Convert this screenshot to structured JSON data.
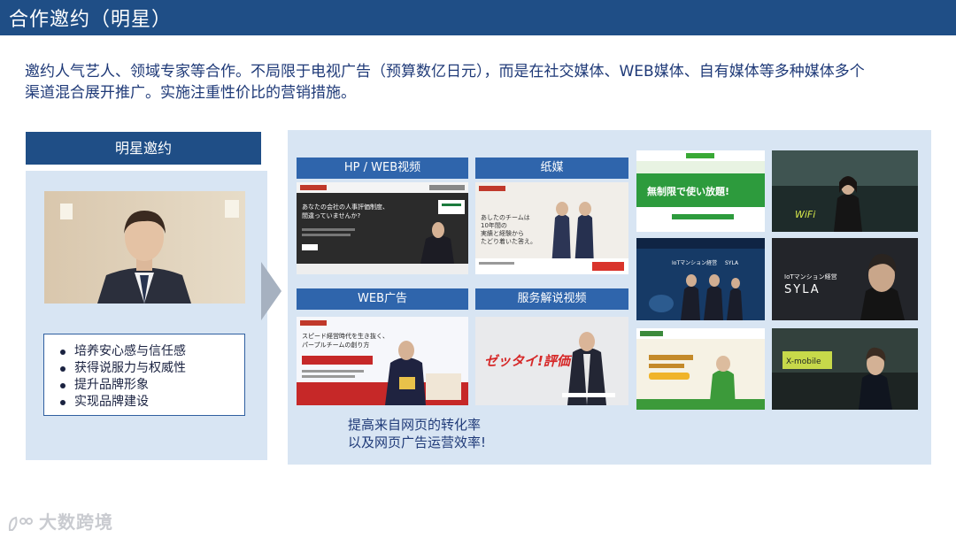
{
  "title": "合作邀约（明星）",
  "intro": {
    "line1": "邀约人气艺人、领域专家等合作。不局限于电视广告（预算数亿日元），而是在社交媒体、WEB媒体、自有媒体等多种媒体多个",
    "line2": "渠道混合展开推广。实施注重性价比的营销措施。"
  },
  "left": {
    "header": "明星邀约",
    "benefits": [
      "培养安心感与信任感",
      "获得说服力与权威性",
      "提升品牌形象",
      "实现品牌建设"
    ]
  },
  "categories": [
    {
      "label": "HP / WEB视频"
    },
    {
      "label": "纸媒"
    },
    {
      "label": "WEB广告"
    },
    {
      "label": "服务解说视频"
    }
  ],
  "shots": {
    "hp_headline": "あなたの会社の人事評価制度、",
    "hp_headline2": "間違っていませんか?",
    "print_headline": "あしたのチームは",
    "print_headline2": "10年間の",
    "print_headline3": "実績と経験から",
    "print_headline4": "たどり着いた答え。",
    "webad_headline": "スピード経営時代を生き抜く、",
    "webad_headline2": "パープルチームの創り方",
    "video_logo": "ゼッタイ!評価",
    "grid1_text": "無制限で使い放題!",
    "grid2_text": "WiFi",
    "grid3_text": "IoTマンション経営",
    "grid3_brand": "SYLA",
    "grid4_text": "IoTマンション経営",
    "grid4_brand": "SYLA",
    "grid6_text": "X-mobile"
  },
  "caption": {
    "line1": "提高来自网页的转化率",
    "line2": "以及网页广告运营效率!"
  },
  "watermark": "大数跨境",
  "colors": {
    "title_bar": "#1f4e86",
    "panel": "#d8e5f3",
    "label": "#2f65ac",
    "text": "#1f3a78"
  }
}
